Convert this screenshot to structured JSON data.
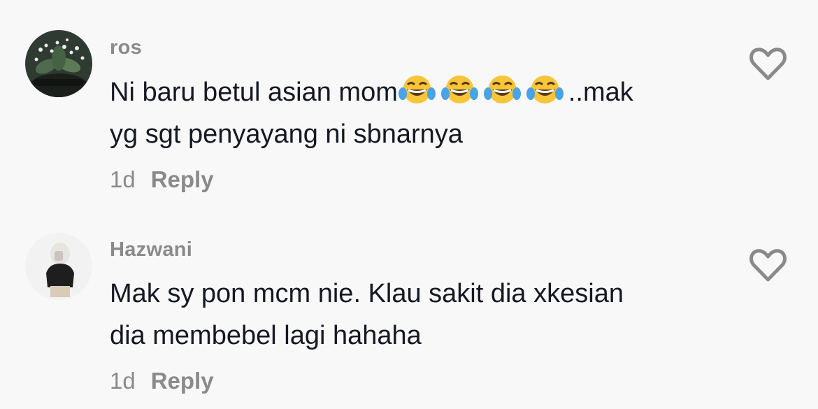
{
  "comments": [
    {
      "username": "ros",
      "line1_text": "Ni baru betul asian mom",
      "line1_suffix": "..mak",
      "line2_text": "yg sgt penyayang ni sbnarnya",
      "emoji_icon": "face-with-tears-of-joy-icon",
      "emoji_count": 4,
      "time": "1d",
      "reply_label": "Reply"
    },
    {
      "username": "Hazwani",
      "line1_text": "Mak sy pon mcm nie. Klau sakit dia xkesian",
      "line2_text": "dia membebel lagi hahaha",
      "time": "1d",
      "reply_label": "Reply"
    }
  ],
  "colors": {
    "background": "#f8f8f8",
    "username": "#8a8a8a",
    "text": "#161823",
    "meta": "#8a8a8a",
    "heart_outline": "#8a8a8a"
  }
}
